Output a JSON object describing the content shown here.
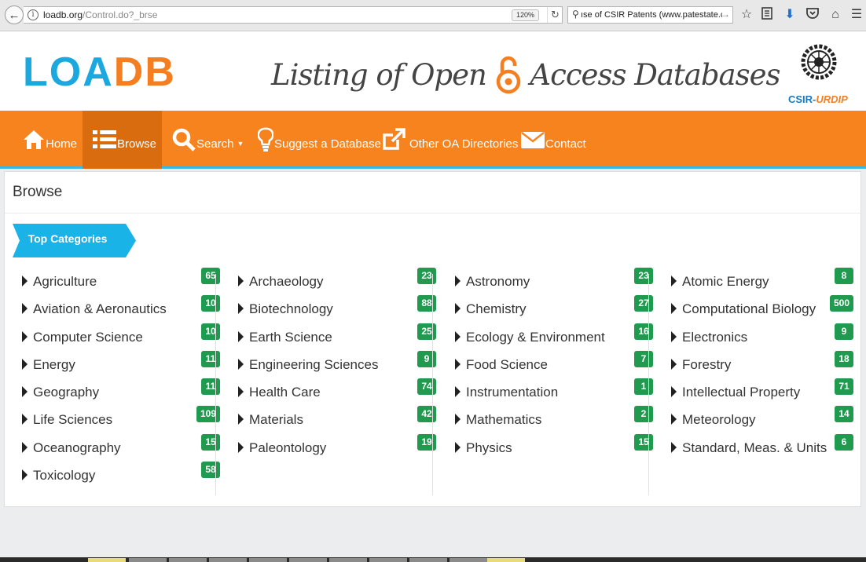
{
  "browser": {
    "url_domain": "loadb.org",
    "url_path": "/Control.do?_brse",
    "zoom": "120%",
    "search_text": "ıse of CSIR Patents (www.patestate.com)"
  },
  "header": {
    "logo_left": "LOA",
    "logo_right": "DB",
    "tagline_left": "Listing of Open",
    "tagline_right": "Access Databases",
    "org_label_main": "CSIR-",
    "org_label_sub": "URDIP"
  },
  "nav": {
    "items": [
      {
        "label": "Home",
        "icon": "home-icon"
      },
      {
        "label": "Browse",
        "icon": "list-icon"
      },
      {
        "label": "Search",
        "icon": "search-icon"
      },
      {
        "label": "Suggest a Database",
        "icon": "bulb-icon"
      },
      {
        "label": "Other OA Directories",
        "icon": "external-link-icon"
      },
      {
        "label": "Contact",
        "icon": "envelope-icon"
      }
    ],
    "active": "Browse",
    "accent": "#f6831e"
  },
  "panel": {
    "title": "Browse",
    "ribbon_label": "Top Categories"
  },
  "categories": [
    [
      {
        "name": "Agriculture",
        "count": "65"
      },
      {
        "name": "Aviation & Aeronautics",
        "count": "10"
      },
      {
        "name": "Computer Science",
        "count": "10"
      },
      {
        "name": "Energy",
        "count": "11"
      },
      {
        "name": "Geography",
        "count": "11"
      },
      {
        "name": "Life Sciences",
        "count": "109"
      },
      {
        "name": "Oceanography",
        "count": "15"
      },
      {
        "name": "Toxicology",
        "count": "58"
      }
    ],
    [
      {
        "name": "Archaeology",
        "count": "23"
      },
      {
        "name": "Biotechnology",
        "count": "88"
      },
      {
        "name": "Earth Science",
        "count": "25"
      },
      {
        "name": "Engineering Sciences",
        "count": "9"
      },
      {
        "name": "Health Care",
        "count": "74"
      },
      {
        "name": "Materials",
        "count": "42"
      },
      {
        "name": "Paleontology",
        "count": "19"
      }
    ],
    [
      {
        "name": "Astronomy",
        "count": "23"
      },
      {
        "name": "Chemistry",
        "count": "27"
      },
      {
        "name": "Ecology & Environment",
        "count": "16"
      },
      {
        "name": "Food Science",
        "count": "7"
      },
      {
        "name": "Instrumentation",
        "count": "1"
      },
      {
        "name": "Mathematics",
        "count": "2"
      },
      {
        "name": "Physics",
        "count": "15"
      }
    ],
    [
      {
        "name": "Atomic Energy",
        "count": "8"
      },
      {
        "name": "Computational Biology",
        "count": "500"
      },
      {
        "name": "Electronics",
        "count": "9"
      },
      {
        "name": "Forestry",
        "count": "18"
      },
      {
        "name": "Intellectual Property",
        "count": "71"
      },
      {
        "name": "Meteorology",
        "count": "14"
      },
      {
        "name": "Standard, Meas. & Units",
        "count": "6"
      }
    ]
  ]
}
